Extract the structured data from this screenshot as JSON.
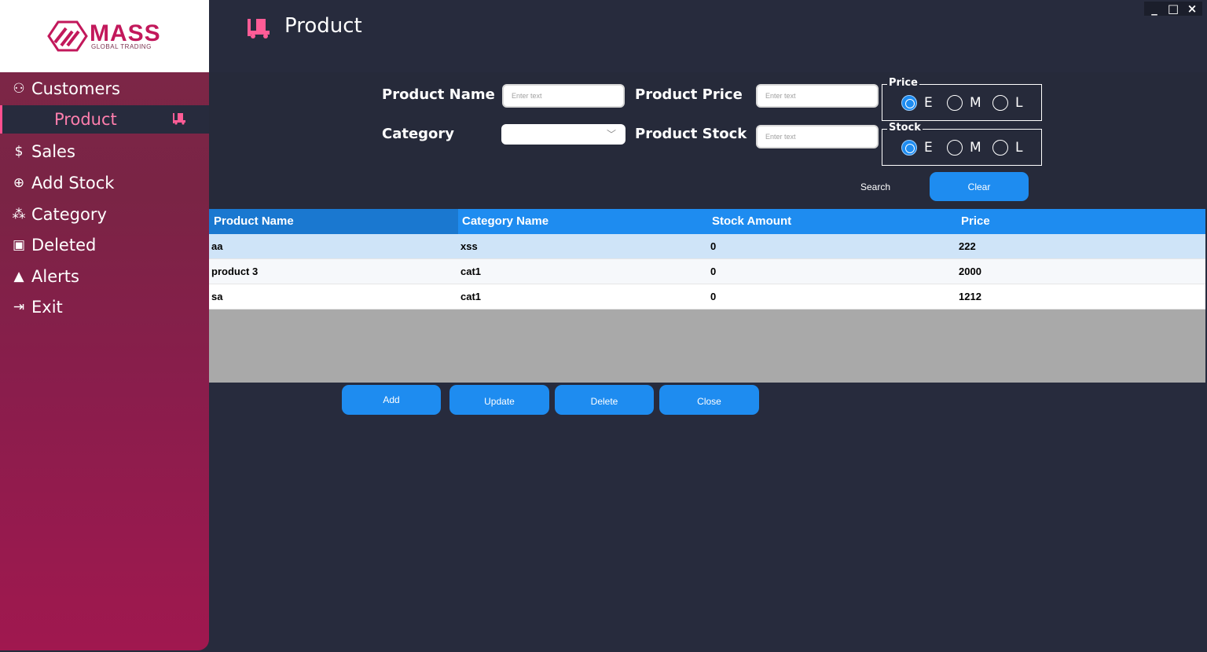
{
  "window": {
    "min": "_",
    "max": "□",
    "close": "×"
  },
  "logo": {
    "title": "MASS",
    "subtitle": "GLOBAL TRADING"
  },
  "sidebar": {
    "items": [
      {
        "label": "Customers",
        "icon": "customers-icon",
        "glyph": "⚇"
      },
      {
        "label": "Product",
        "icon": "forklift-icon",
        "glyph": ""
      },
      {
        "label": "Sales",
        "icon": "sales-hand-icon",
        "glyph": "$"
      },
      {
        "label": "Add Stock",
        "icon": "plus-circle-icon",
        "glyph": "⊕"
      },
      {
        "label": "Category",
        "icon": "sitemap-icon",
        "glyph": "⁂"
      },
      {
        "label": "Deleted",
        "icon": "archive-icon",
        "glyph": "▣"
      },
      {
        "label": "Alerts",
        "icon": "warning-icon",
        "glyph": "▲"
      },
      {
        "label": "Exit",
        "icon": "exit-icon",
        "glyph": "⇥"
      }
    ]
  },
  "header": {
    "title": "Product"
  },
  "form": {
    "product_name_label": "Product Name",
    "product_price_label": "Product Price",
    "category_label": "Category",
    "product_stock_label": "Product Stock",
    "placeholder": "Enter text",
    "category_value": "",
    "price_group": {
      "legend": "Price",
      "options": [
        "E",
        "M",
        "L"
      ],
      "selected": "E"
    },
    "stock_group": {
      "legend": "Stock",
      "options": [
        "E",
        "M",
        "L"
      ],
      "selected": "E"
    },
    "search_label": "Search",
    "clear_label": "Clear"
  },
  "table": {
    "columns": [
      "Product Name",
      "Category Name",
      "Stock Amount",
      "Price"
    ],
    "rows": [
      [
        "aa",
        "xss",
        "0",
        "222"
      ],
      [
        "product 3",
        "cat1",
        "0",
        "2000"
      ],
      [
        "sa",
        "cat1",
        "0",
        "1212"
      ]
    ]
  },
  "actions": {
    "add": "Add",
    "update": "Update",
    "delete": "Delete",
    "close": "Close"
  },
  "colors": {
    "accent": "#1e8cf0",
    "brand": "#c2185b",
    "background": "#272b3d"
  }
}
